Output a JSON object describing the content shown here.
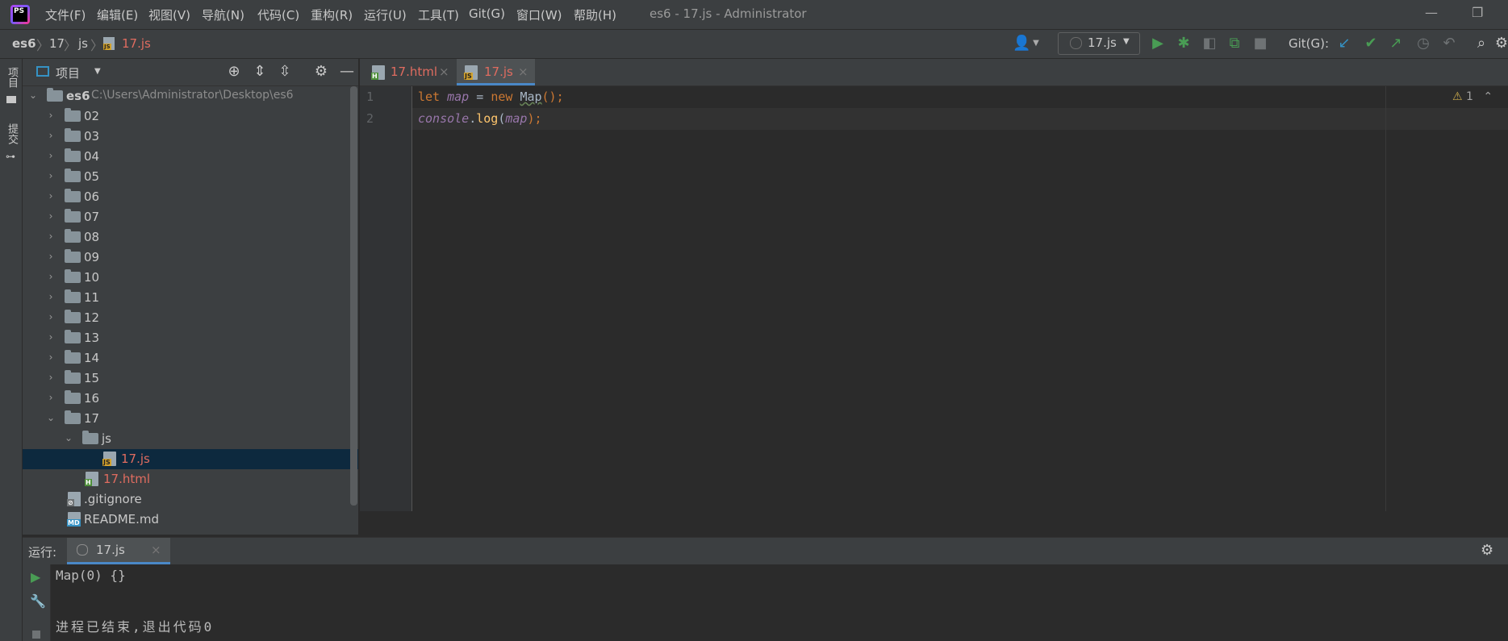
{
  "titlebar": {
    "app_logo": "PS",
    "menus": [
      "文件(F)",
      "编辑(E)",
      "视图(V)",
      "导航(N)",
      "代码(C)",
      "重构(R)",
      "运行(U)",
      "工具(T)",
      "Git(G)",
      "窗口(W)",
      "帮助(H)"
    ],
    "window_title": "es6 - 17.js - Administrator",
    "minimize": "—",
    "restore": "❐"
  },
  "breadcrumb": [
    "es6",
    "17",
    "js",
    "17.js"
  ],
  "toolbar": {
    "run_config": "17.js",
    "git_label": "Git(G):"
  },
  "left_stripe": {
    "project_tab": "项目",
    "commit_tab": "提交"
  },
  "project": {
    "title": "项目",
    "root_name": "es6",
    "root_path": "C:\\Users\\Administrator\\Desktop\\es6",
    "folders": [
      "02",
      "03",
      "04",
      "05",
      "06",
      "07",
      "08",
      "09",
      "10",
      "11",
      "12",
      "13",
      "14",
      "15",
      "16"
    ],
    "open_folder": "17",
    "sub_folder": "js",
    "selected_file": "17.js",
    "html_file": "17.html",
    "gitignore": ".gitignore",
    "readme": "README.md"
  },
  "editor": {
    "tabs": [
      {
        "label": "17.html",
        "active": false
      },
      {
        "label": "17.js",
        "active": true
      }
    ],
    "line_numbers": [
      "1",
      "2"
    ],
    "line1": {
      "kw1": "let",
      "var": "map",
      "eq": " = ",
      "kw2": "new",
      "cls": "Map",
      "rest": "();"
    },
    "line2": {
      "obj": "console",
      "dot": ".",
      "fn": "log",
      "open": "(",
      "arg": "map",
      "close": ");"
    },
    "warning_count": "1"
  },
  "run_panel": {
    "label": "运行:",
    "tab": "17.js",
    "output_line1": "Map(0) {}",
    "output_line2": "进程已结束,退出代码0"
  },
  "colors": {
    "accent": "#4a88c7",
    "run_green": "#499c54",
    "file_red": "#e06c60"
  }
}
